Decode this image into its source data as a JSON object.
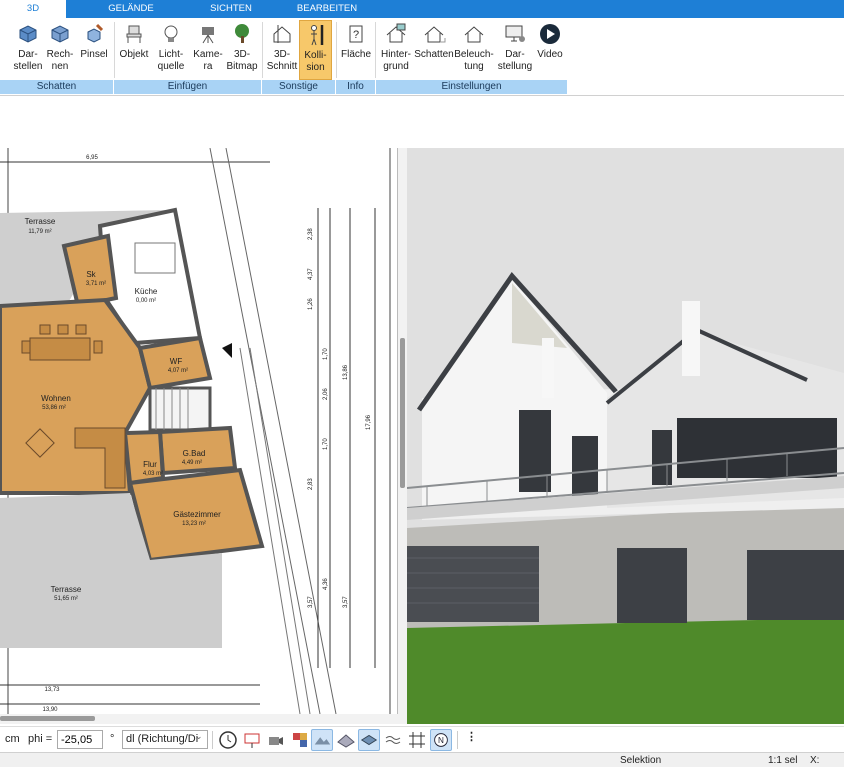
{
  "tabs": [
    {
      "label": "3D",
      "active": true
    },
    {
      "label": "GELÄNDE",
      "active": false
    },
    {
      "label": "SICHTEN",
      "active": false
    },
    {
      "label": "BEARBEITEN",
      "active": false
    }
  ],
  "ribbon": {
    "buttons": [
      {
        "label": "Dar-\nstellen",
        "icon": "cube-display-icon"
      },
      {
        "label": "Rech-\nnen",
        "icon": "cube-compute-icon"
      },
      {
        "label": "Pinsel",
        "icon": "brush-cube-icon"
      },
      {
        "label": "Objekt",
        "icon": "chair-icon"
      },
      {
        "label": "Licht-\nquelle",
        "icon": "lightbulb-icon"
      },
      {
        "label": "Kame-\nra",
        "icon": "camera-icon"
      },
      {
        "label": "3D-\nBitmap",
        "icon": "tree-icon"
      },
      {
        "label": "3D-\nSchnitt",
        "icon": "section-house-icon"
      },
      {
        "label": "Kolli-\nsion",
        "icon": "collision-person-icon"
      },
      {
        "label": "Fläche",
        "icon": "area-info-icon"
      },
      {
        "label": "Hinter-\ngrund",
        "icon": "background-house-icon"
      },
      {
        "label": "Schatten",
        "icon": "shadow-house-icon"
      },
      {
        "label": "Beleuch-\ntung",
        "icon": "lighting-house-icon"
      },
      {
        "label": "Dar-\nstellung",
        "icon": "monitor-settings-icon"
      },
      {
        "label": "Video",
        "icon": "play-icon"
      }
    ],
    "groups": [
      "Schatten",
      "Einfügen",
      "Sonstige",
      "Info",
      "Einstellungen"
    ]
  },
  "plan": {
    "rooms": [
      {
        "name": "Terrasse",
        "area": "11,79 m²"
      },
      {
        "name": "Sk",
        "area": "3,71 m²"
      },
      {
        "name": "Küche",
        "area": "0,00 m²"
      },
      {
        "name": "WF",
        "area": "4,07 m²"
      },
      {
        "name": "Wohnen",
        "area": "53,86 m²"
      },
      {
        "name": "G.Bad",
        "area": "4,49 m²"
      },
      {
        "name": "Flur",
        "area": "4,03 m²"
      },
      {
        "name": "Gästezimmer",
        "area": "13,23 m²"
      },
      {
        "name": "Terrasse",
        "area": "51,65 m²"
      }
    ],
    "dimensions": [
      "6,95",
      "2,38",
      "4,37",
      "1,26",
      "1,70",
      "2,06",
      "1,70",
      "2,83",
      "4,36",
      "3,57",
      "3,57",
      "13,86",
      "17,96",
      "13,73",
      "13,90"
    ]
  },
  "toolbar": {
    "unit": "cm",
    "phi_label": "phi =",
    "phi_value": "-25,05",
    "degree": "°",
    "dl_value": "dl (Richtung/Di"
  },
  "status": {
    "mode": "Selektion",
    "scale": "1:1 sel",
    "coord_label": "X:"
  },
  "colors": {
    "ribbon_blue": "#1e7fd6",
    "group_blue": "#a9d3f5",
    "active_button": "#f7c86a",
    "floor_wood": "#d9a15a",
    "terrace_gray": "#c8c8c8",
    "lawn_green": "#4f8a2a"
  }
}
